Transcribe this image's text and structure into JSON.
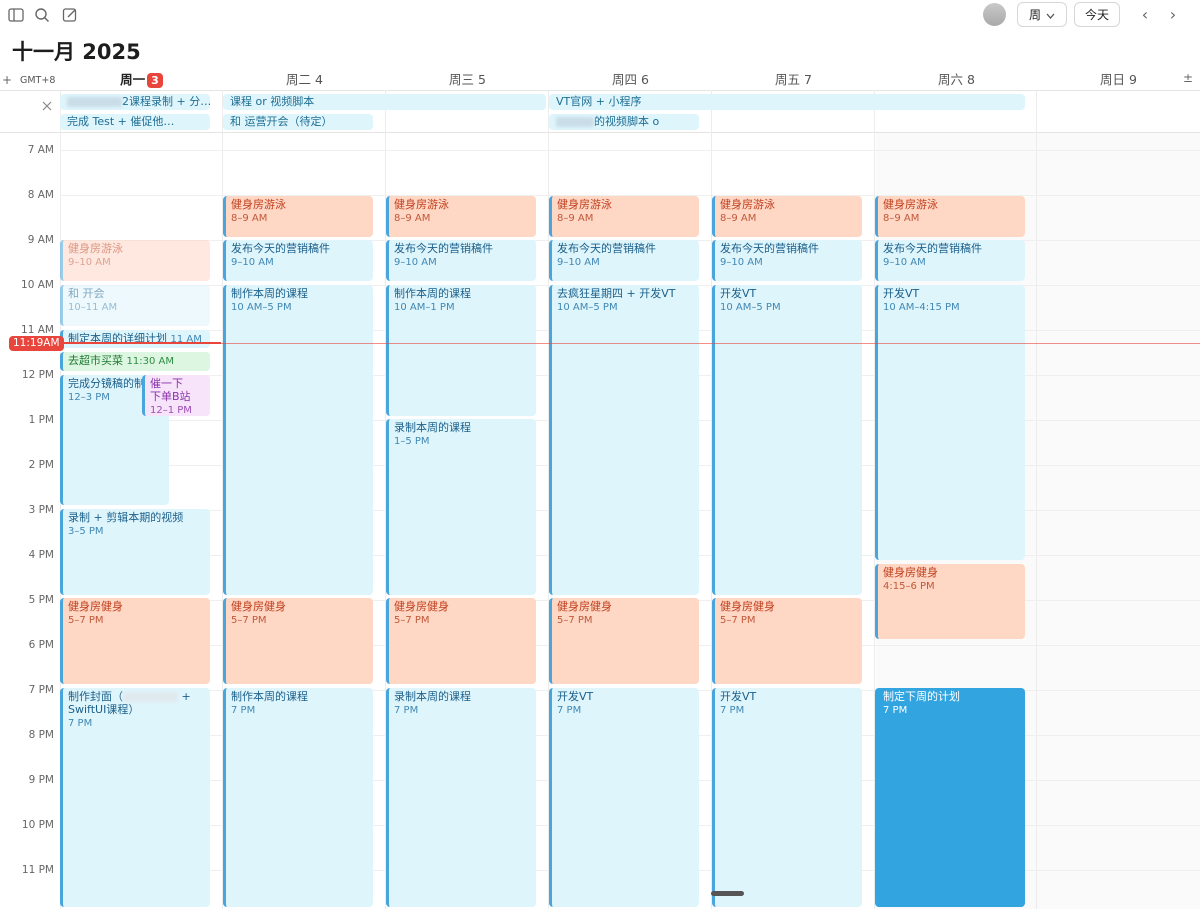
{
  "toolbar": {
    "view_label": "周",
    "today_label": "今天",
    "prev": "‹",
    "next": "›"
  },
  "calendar": {
    "title": "十一月 2025",
    "timezone": "GMT+8",
    "add_label": "+",
    "collapse_label": "±",
    "days": [
      {
        "label": "周一",
        "num": "3",
        "today": true
      },
      {
        "label": "周二",
        "num": "4"
      },
      {
        "label": "周三",
        "num": "5"
      },
      {
        "label": "周四",
        "num": "6"
      },
      {
        "label": "周五",
        "num": "7"
      },
      {
        "label": "周六",
        "num": "8"
      },
      {
        "label": "周日",
        "num": "9"
      }
    ],
    "hours": [
      "7 AM",
      "8 AM",
      "9 AM",
      "10 AM",
      "11 AM",
      "12 PM",
      "1 PM",
      "2 PM",
      "3 PM",
      "4 PM",
      "5 PM",
      "6 PM",
      "7 PM",
      "8 PM",
      "9 PM",
      "10 PM",
      "11 PM"
    ],
    "now_label": "11:19AM",
    "all_day": [
      {
        "title": "2课程录制 + 分…"
      },
      {
        "title": "完成      Test + 催促他…"
      },
      {
        "title": "课程 or        视频脚本"
      },
      {
        "title": "和      运营开会（待定）"
      },
      {
        "title": "VT官网 + 小程序"
      },
      {
        "title": "的视频脚本 o"
      }
    ],
    "events": [
      {
        "title": "健身房游泳",
        "time": "9–10 AM"
      },
      {
        "title": "和      开会",
        "time": "10–11 AM"
      },
      {
        "title": "制定本周的详细计划",
        "time": "11 AM"
      },
      {
        "title": "去超市买菜",
        "time": "11:30 AM"
      },
      {
        "title": "完成分镜稿的制作",
        "time": "12–3 PM"
      },
      {
        "title": "催一下",
        "title2": "下单B站",
        "time": "12–1 PM"
      },
      {
        "title": "录制 + 剪辑本期的视频",
        "time": "3–5 PM"
      },
      {
        "title": "健身房健身",
        "time": "5–7 PM"
      },
      {
        "title": "制作封面（",
        "title2": "SwiftUI课程）",
        "plus": "+",
        "time": "7 PM"
      },
      {
        "title": "健身房游泳",
        "time": "8–9 AM"
      },
      {
        "title": "发布今天的营销稿件",
        "time": "9–10 AM"
      },
      {
        "title": "制作本周的课程",
        "time": "10 AM–5 PM"
      },
      {
        "title": "健身房健身",
        "time": "5–7 PM"
      },
      {
        "title": "制作本周的课程",
        "time": "7 PM"
      },
      {
        "title": "健身房游泳",
        "time": "8–9 AM"
      },
      {
        "title": "发布今天的营销稿件",
        "time": "9–10 AM"
      },
      {
        "title": "制作本周的课程",
        "time": "10 AM–1 PM"
      },
      {
        "title": "录制本周的课程",
        "time": "1–5 PM"
      },
      {
        "title": "健身房健身",
        "time": "5–7 PM"
      },
      {
        "title": "录制本周的课程",
        "time": "7 PM"
      },
      {
        "title": "健身房游泳",
        "time": "8–9 AM"
      },
      {
        "title": "发布今天的营销稿件",
        "time": "9–10 AM"
      },
      {
        "title": "去疯狂星期四 + 开发VT",
        "time": "10 AM–5 PM"
      },
      {
        "title": "健身房健身",
        "time": "5–7 PM"
      },
      {
        "title": "开发VT",
        "time": "7 PM"
      },
      {
        "title": "健身房游泳",
        "time": "8–9 AM"
      },
      {
        "title": "发布今天的营销稿件",
        "time": "9–10 AM"
      },
      {
        "title": "开发VT",
        "time": "10 AM–5 PM"
      },
      {
        "title": "健身房健身",
        "time": "5–7 PM"
      },
      {
        "title": "开发VT",
        "time": "7 PM"
      },
      {
        "title": "健身房游泳",
        "time": "8–9 AM"
      },
      {
        "title": "发布今天的营销稿件",
        "time": "9–10 AM"
      },
      {
        "title": "开发VT",
        "time": "10 AM–4:15 PM"
      },
      {
        "title": "健身房健身",
        "time": "4:15–6 PM"
      },
      {
        "title": "制定下周的计划",
        "time": "7 PM"
      }
    ]
  },
  "icons": [
    "sidebar-icon",
    "search-icon",
    "compose-icon",
    "chevron-down-icon",
    "chevron-left-icon",
    "chevron-right-icon",
    "close-x-icon"
  ],
  "colors": {
    "today_red": "#e8453c",
    "event_blue_bg": "#dff5fc",
    "event_orange_bg": "#ffd7c5",
    "accent_blue": "#32a4e0"
  }
}
